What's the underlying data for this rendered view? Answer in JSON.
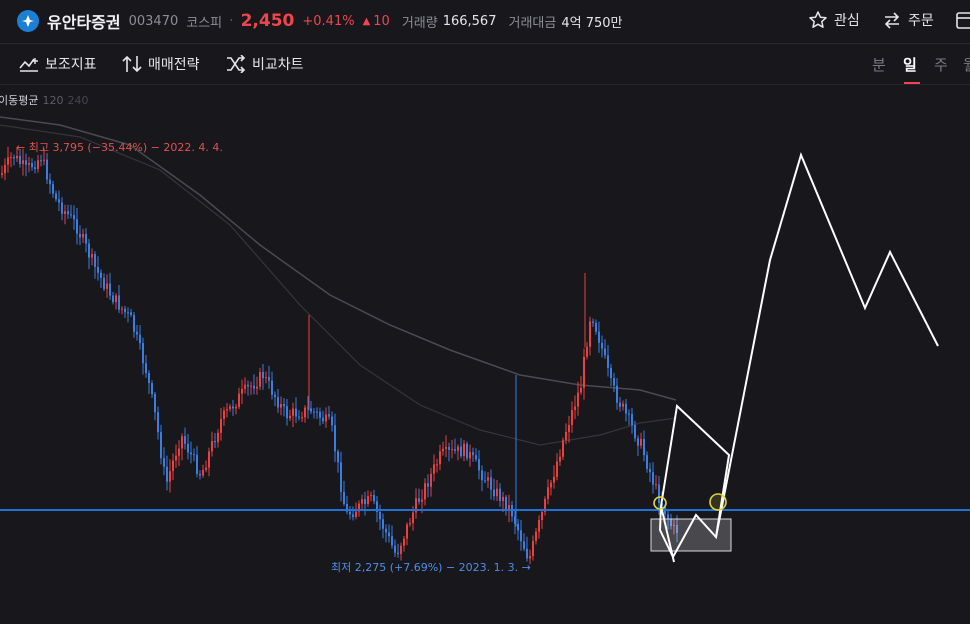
{
  "header": {
    "stock_name": "유안타증권",
    "stock_code": "003470",
    "market": "코스피",
    "separator": "·",
    "price": "2,450",
    "change_percent": "+0.41%",
    "change_arrow": "▲",
    "change_amount": "10",
    "volume_label": "거래량",
    "volume_value": "166,567",
    "turnover_label": "거래대금",
    "turnover_value": "4억 750만",
    "watch_label": "관심",
    "order_label": "주문"
  },
  "toolbar": {
    "indicators_label": "보조지표",
    "strategy_label": "매매전략",
    "compare_label": "비교차트",
    "timeframes": [
      "분",
      "일",
      "주",
      "월"
    ],
    "active_timeframe": "일"
  },
  "ma_legend": {
    "title": "이동평균",
    "periods": [
      "120",
      "240"
    ]
  },
  "chart_data": {
    "type": "candlestick",
    "high_annotation": "← 최고 3,795 (−35.44%) − 2022. 4. 4.",
    "low_annotation": "최저 2,275 (+7.69%) − 2023. 1. 3. →",
    "high_value": 3795,
    "low_value": 2275,
    "horizontal_line_value": 2420,
    "colors": {
      "up": "#e8413f",
      "down": "#3b7ee0",
      "ma120": "#4a4a50",
      "ma240": "#35353b",
      "hline": "#1e72d8",
      "drawing": "#ffffff",
      "circle": "#e1d33f"
    }
  }
}
